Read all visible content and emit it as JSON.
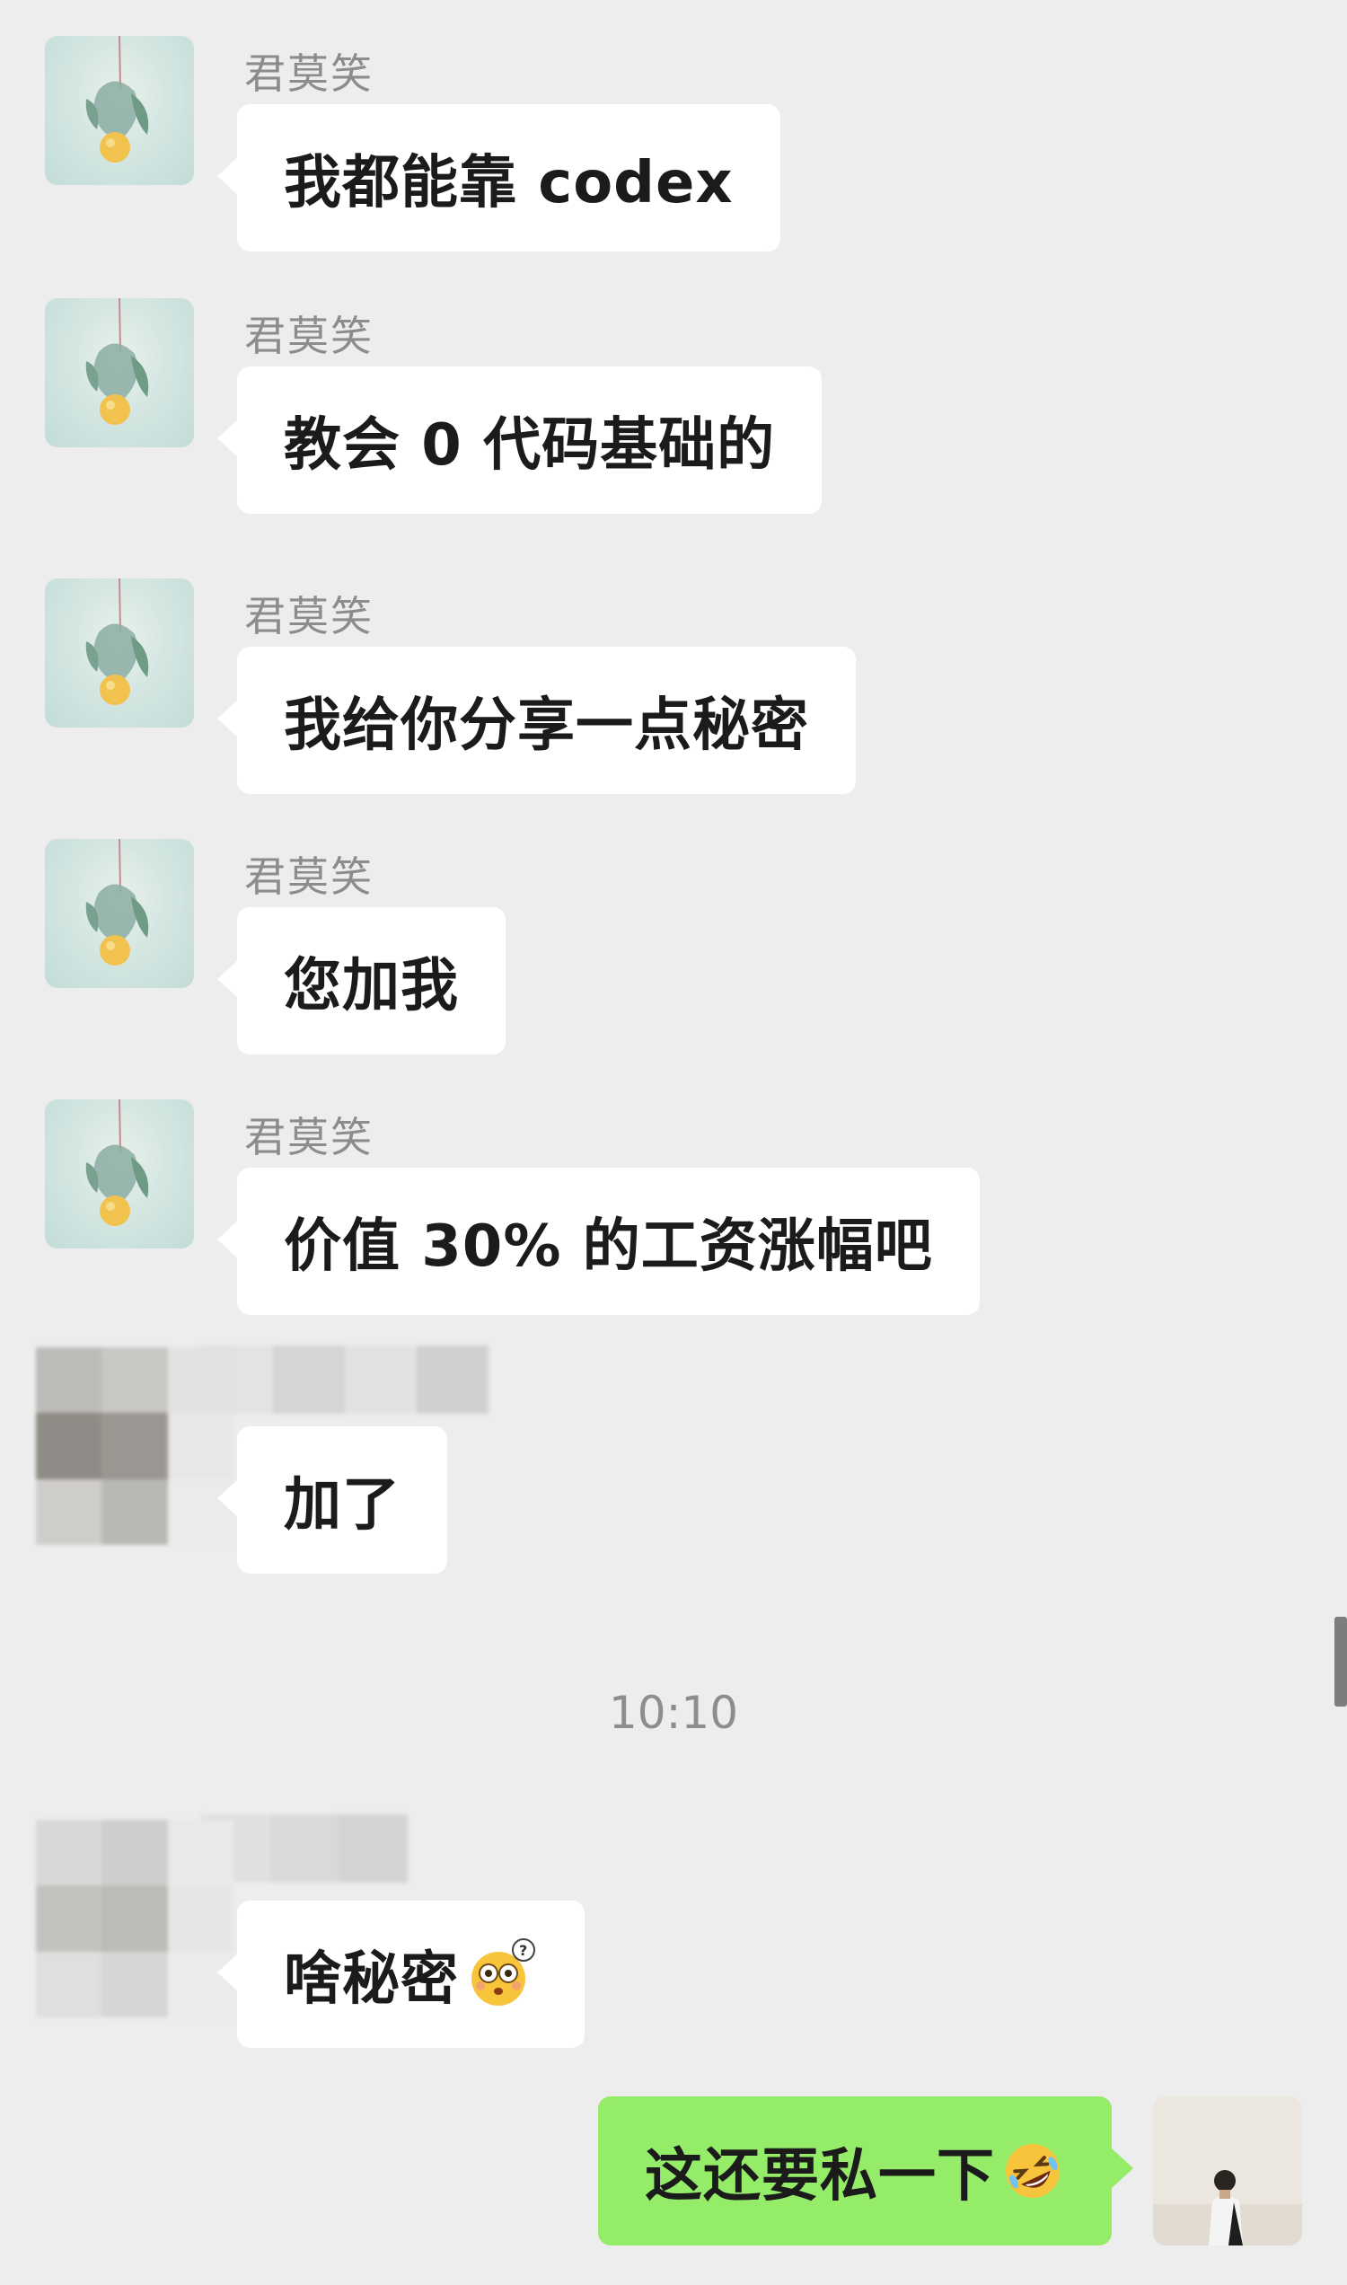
{
  "messages": [
    {
      "sender": "君莫笑",
      "text": "我都能靠 codex"
    },
    {
      "sender": "君莫笑",
      "text": "教会 0 代码基础的"
    },
    {
      "sender": "君莫笑",
      "text": "我给你分享一点秘密"
    },
    {
      "sender": "君莫笑",
      "text": "您加我"
    },
    {
      "sender": "君莫笑",
      "text": "价值 30% 的工资涨幅吧"
    },
    {
      "sender": "",
      "text": "加了"
    },
    {
      "sender": "",
      "text": "啥秘密",
      "emoji": "flushed-thinking-emoji"
    },
    {
      "sender": "me",
      "text": "这还要私一下",
      "emoji": "rofl-emoji"
    }
  ],
  "timestamp": "10:10",
  "colors": {
    "background": "#ededed",
    "incoming_bubble": "#ffffff",
    "outgoing_bubble": "#95ec69",
    "name_text": "#8c8c8c"
  },
  "icons": {
    "sender_avatar": "lemon-avatar-icon",
    "self_avatar": "person-avatar-icon"
  }
}
